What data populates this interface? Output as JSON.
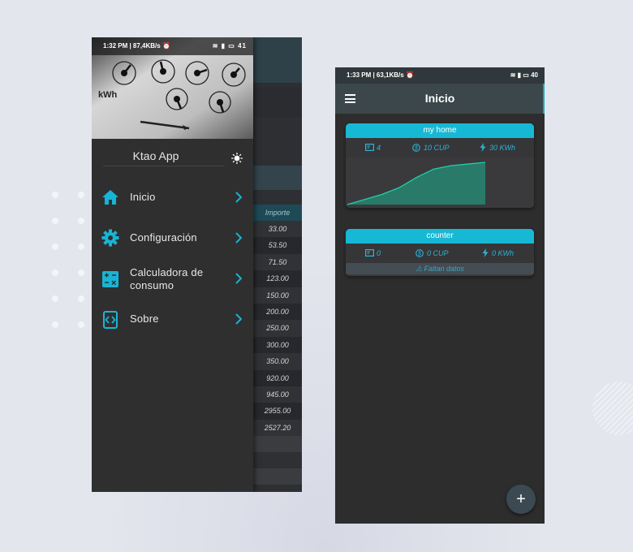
{
  "left_phone": {
    "status_bar": {
      "time": "1:32 PM | 87,4KB/s ⏰",
      "battery": "41"
    },
    "drawer": {
      "app_name": "Ktao App",
      "menu_items": [
        {
          "label": "Inicio",
          "icon": "home-icon"
        },
        {
          "label": "Configuración",
          "icon": "gear-icon"
        },
        {
          "label": "Calculadora de consumo",
          "icon": "calculator-icon"
        },
        {
          "label": "Sobre",
          "icon": "code-icon"
        }
      ]
    },
    "background_table": {
      "header": "Importe",
      "values": [
        "33.00",
        "53.50",
        "71.50",
        "123.00",
        "150.00",
        "200.00",
        "250.00",
        "300.00",
        "350.00",
        "920.00",
        "945.00",
        "2955.00",
        "2527.20"
      ]
    }
  },
  "right_phone": {
    "status_bar": {
      "time": "1:33 PM | 63,1KB/s ⏰",
      "battery": "40"
    },
    "app_bar": {
      "title": "Inicio"
    },
    "cards": [
      {
        "title": "my home",
        "meter_count": "4",
        "cost": "10 CUP",
        "energy": "30 KWh",
        "chart_data": {
          "type": "area",
          "values": [
            0,
            3,
            6,
            10,
            16,
            21,
            23,
            24,
            25
          ]
        }
      },
      {
        "title": "counter",
        "meter_count": "0",
        "cost": "0 CUP",
        "energy": "0 KWh",
        "warning": "Faltan datos"
      }
    ],
    "fab_label": "+"
  },
  "colors": {
    "accent": "#17b8d4",
    "chart_fill": "#2a7a6a",
    "chart_line": "#1fd0a8"
  }
}
